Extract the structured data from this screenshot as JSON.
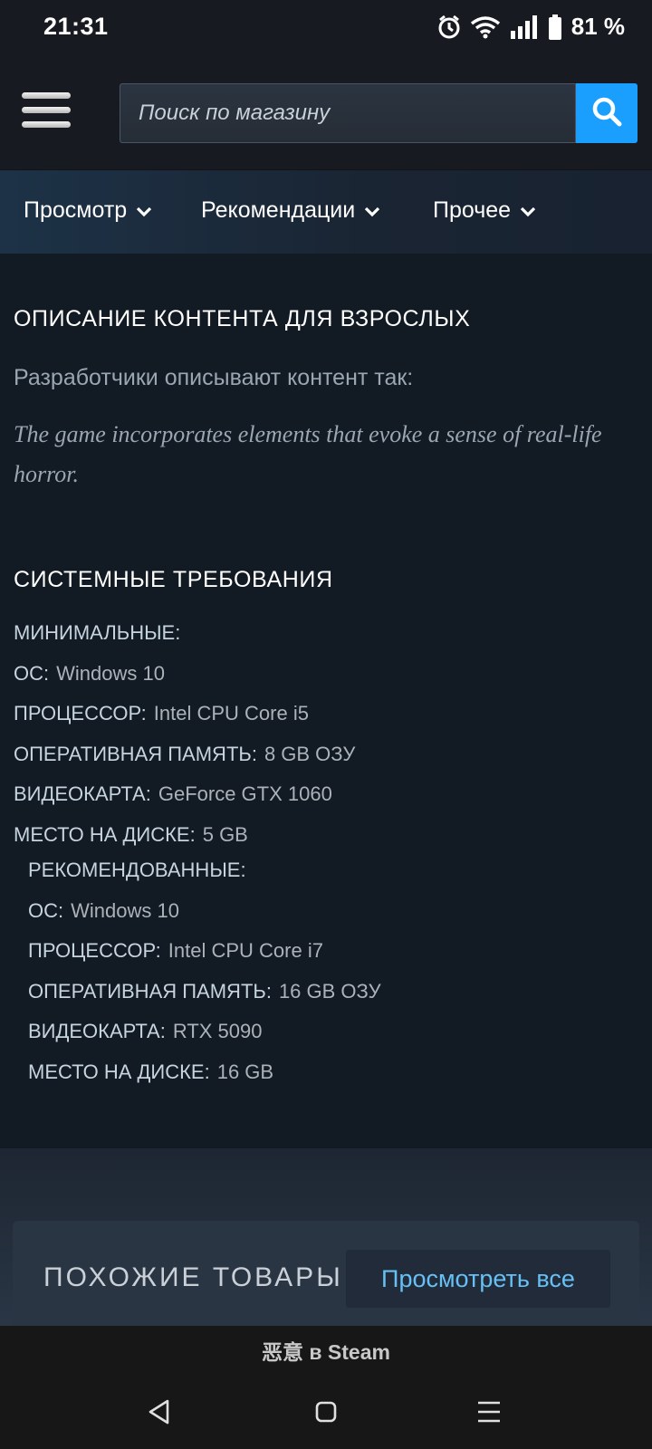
{
  "status_bar": {
    "time": "21:31",
    "battery": "81 %",
    "icons": [
      "alarm-icon",
      "wifi-icon",
      "signal-icon",
      "battery-icon"
    ]
  },
  "header": {
    "search_placeholder": "Поиск по магазину",
    "accent_color": "#1a9fff"
  },
  "nav": {
    "items": [
      {
        "label": "Просмотр"
      },
      {
        "label": "Рекомендации"
      },
      {
        "label": "Прочее"
      }
    ]
  },
  "mature": {
    "title": "ОПИСАНИЕ КОНТЕНТА ДЛЯ ВЗРОСЛЫХ",
    "intro": "Разработчики описывают контент так:",
    "description": "The game incorporates elements that evoke a sense of real-life horror."
  },
  "sysreq": {
    "title": "СИСТЕМНЫЕ ТРЕБОВАНИЯ",
    "minimum": {
      "heading": "МИНИМАЛЬНЫЕ:",
      "rows": [
        {
          "label": "ОС:",
          "value": "Windows 10"
        },
        {
          "label": "ПРОЦЕССОР:",
          "value": "Intel CPU Core i5"
        },
        {
          "label": "ОПЕРАТИВНАЯ ПАМЯТЬ:",
          "value": "8 GB ОЗУ"
        },
        {
          "label": "ВИДЕОКАРТА:",
          "value": "GeForce GTX 1060"
        },
        {
          "label": "МЕСТО НА ДИСКЕ:",
          "value": "5 GB"
        }
      ]
    },
    "recommended": {
      "heading": "РЕКОМЕНДОВАННЫЕ:",
      "rows": [
        {
          "label": "ОС:",
          "value": "Windows 10"
        },
        {
          "label": "ПРОЦЕССОР:",
          "value": "Intel CPU Core i7"
        },
        {
          "label": "ОПЕРАТИВНАЯ ПАМЯТЬ:",
          "value": "16 GB ОЗУ"
        },
        {
          "label": "ВИДЕОКАРТА:",
          "value": "RTX 5090"
        },
        {
          "label": "МЕСТО НА ДИСКЕ:",
          "value": "16 GB"
        }
      ]
    }
  },
  "similar": {
    "title": "ПОХОЖИЕ ТОВАРЫ",
    "view_all": "Просмотреть все"
  },
  "browser": {
    "page_title": "恶意 в Steam"
  }
}
